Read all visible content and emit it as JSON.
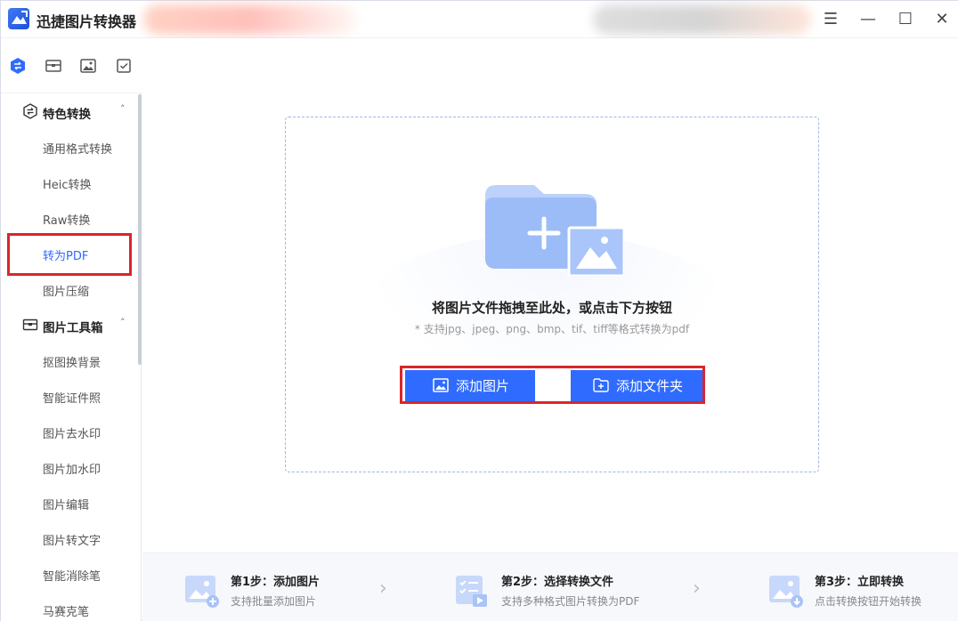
{
  "app": {
    "title": "迅捷图片转换器",
    "accent": "#2f6bff",
    "highlight": "#d9262b"
  },
  "window_controls": {
    "menu": "☰",
    "minimize": "—",
    "maximize": "☐",
    "close": "✕"
  },
  "sidebar": {
    "tabs": [
      "convert-icon",
      "toolbox-icon",
      "image-edit-icon",
      "check-icon"
    ],
    "groups": [
      {
        "label": "特色转换",
        "caret": "˄",
        "items": [
          "通用格式转换",
          "Heic转换",
          "Raw转换",
          "转为PDF",
          "图片压缩"
        ]
      },
      {
        "label": "图片工具箱",
        "caret": "˄",
        "items": [
          "抠图换背景",
          "智能证件照",
          "图片去水印",
          "图片加水印",
          "图片编辑",
          "图片转文字",
          "智能消除笔",
          "马赛克笔"
        ]
      }
    ],
    "active_item": "转为PDF"
  },
  "dropzone": {
    "title": "将图片文件拖拽至此处，或点击下方按钮",
    "subtitle": "* 支持jpg、jpeg、png、bmp、tif、tiff等格式转换为pdf",
    "add_image_button": "添加图片",
    "add_folder_button": "添加文件夹"
  },
  "steps": [
    {
      "title": "第1步：添加图片",
      "desc": "支持批量添加图片"
    },
    {
      "title": "第2步：选择转换文件",
      "desc": "支持多种格式图片转换为PDF"
    },
    {
      "title": "第3步：立即转换",
      "desc": "点击转换按钮开始转换"
    }
  ],
  "step_arrow": "›"
}
